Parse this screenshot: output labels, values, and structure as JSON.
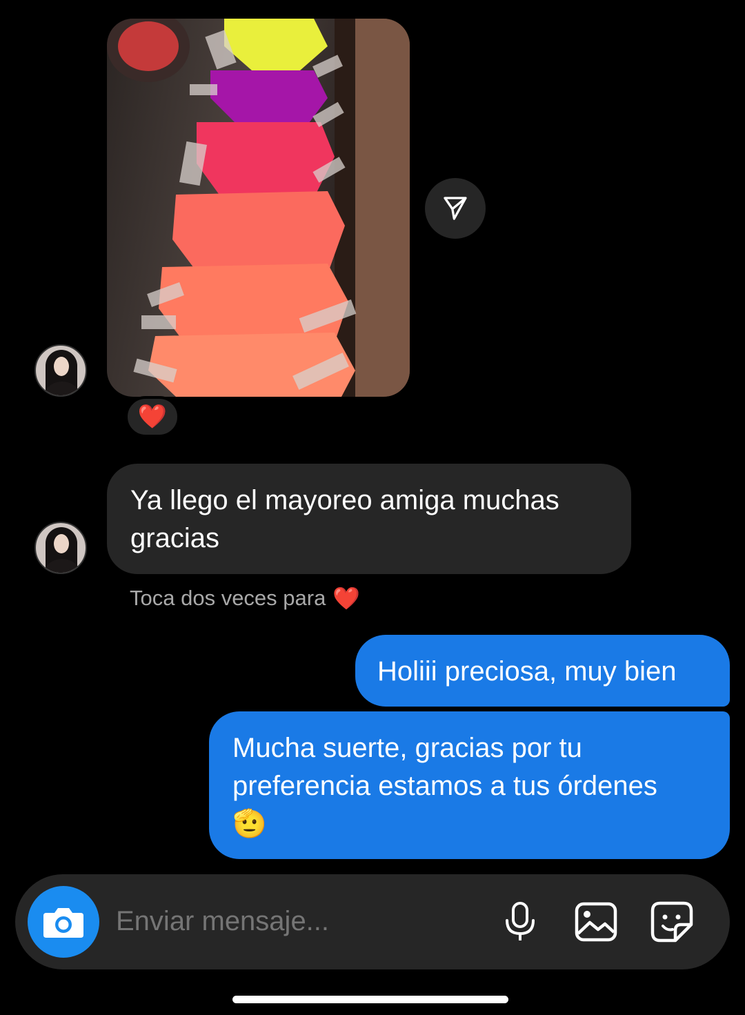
{
  "conversation": {
    "incoming_image": {
      "description_icon": "photo-attachment",
      "reaction": "❤️"
    },
    "incoming_message": {
      "text": "Ya llego el mayoreo amiga muchas gracias"
    },
    "reaction_hint": {
      "text": "Toca dos veces para",
      "emoji": "❤️"
    },
    "outgoing_messages": [
      {
        "text": "Holiii preciosa, muy bien"
      },
      {
        "text": "Mucha suerte, gracias por tu preferencia estamos a tus órdenes",
        "emoji": "🫡"
      }
    ]
  },
  "composer": {
    "placeholder": "Enviar mensaje...",
    "icons": [
      "camera-icon",
      "microphone-icon",
      "gallery-icon",
      "sticker-icon"
    ]
  },
  "colors": {
    "background": "#000000",
    "incoming_bubble": "#262626",
    "outgoing_bubble": "#1a7ae6",
    "camera_button": "#1a8cf0"
  }
}
